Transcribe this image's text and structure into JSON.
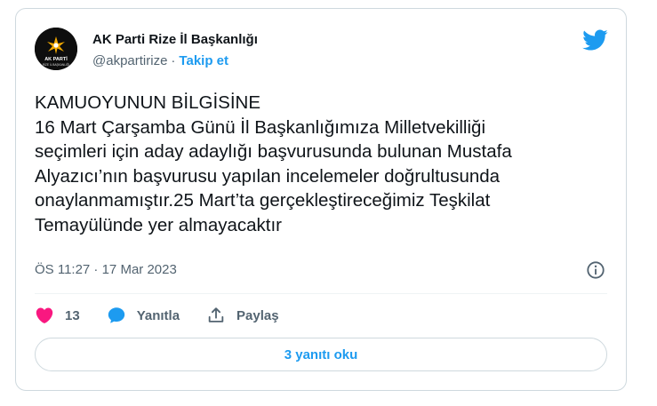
{
  "author": {
    "name": "AK Parti Rize İl Başkanlığı",
    "handle": "@akpartirize",
    "separator": "·",
    "follow_label": "Takip et",
    "avatar_caption": "AK PARTİ",
    "avatar_subcaption": "RİZE İL BAŞKANLIĞI"
  },
  "tweet": {
    "text": "KAMUOYUNUN BİLGİSİNE\n16 Mart Çarşamba Günü İl Başkanlığımıza  Milletvekilliği\nseçimleri için aday adaylığı başvurusunda bulunan Mustafa\nAlyazıcı’nın başvurusu yapılan incelemeler doğrultusunda\nonaylanmamıştır.25 Mart’ta gerçekleştireceğimiz Teşkilat\nTemayülünde yer almayacaktır",
    "timestamp": "ÖS 11:27 · 17 Mar 2023"
  },
  "actions": {
    "likes_count": "13",
    "reply_label": "Yanıtla",
    "share_label": "Paylaş"
  },
  "replies_button_label": "3 yanıtı oku",
  "colors": {
    "accent": "#1d9bf0",
    "like": "#f91880",
    "text": "#0f1419",
    "muted": "#536471",
    "border": "#cfd9de"
  }
}
